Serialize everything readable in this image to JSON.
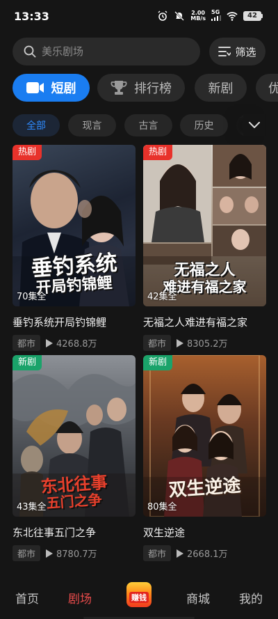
{
  "status": {
    "time": "13:33",
    "net_speed_value": "2.00",
    "net_speed_unit": "MB/s",
    "signal": "5G",
    "battery": "42"
  },
  "search": {
    "placeholder": "美乐剧场"
  },
  "filter": {
    "label": "筛选"
  },
  "main_tabs": [
    {
      "label": "短剧",
      "icon": "video-camera-icon",
      "active": true
    },
    {
      "label": "排行榜",
      "icon": "trophy-icon",
      "active": false
    },
    {
      "label": "新剧",
      "active": false
    },
    {
      "label": "优",
      "active": false
    }
  ],
  "sub_tabs": [
    {
      "label": "全部",
      "active": true
    },
    {
      "label": "现言",
      "active": false
    },
    {
      "label": "古言",
      "active": false
    },
    {
      "label": "历史",
      "active": false
    }
  ],
  "dramas": [
    {
      "title": "垂钓系统开局钓锦鲤",
      "poster_title_line1": "垂钓系统",
      "poster_title_line2": "开局钓锦鲤",
      "badge": "热剧",
      "badge_type": "hot",
      "episodes": "70集全",
      "genre": "都市",
      "views": "4268.8万"
    },
    {
      "title": "无福之人难进有福之家",
      "poster_title_line1": "无福之人",
      "poster_title_line2": "难进有福之家",
      "badge": "热剧",
      "badge_type": "hot",
      "episodes": "42集全",
      "genre": "都市",
      "views": "8305.2万"
    },
    {
      "title": "东北往事五门之争",
      "poster_title_line1": "东北往事",
      "poster_title_line2": "五门之争",
      "badge": "新剧",
      "badge_type": "new",
      "episodes": "43集全",
      "genre": "都市",
      "views": "8780.7万"
    },
    {
      "title": "双生逆途",
      "poster_title_line1": "双生逆途",
      "poster_title_line2": "",
      "badge": "新剧",
      "badge_type": "new",
      "episodes": "80集全",
      "genre": "都市",
      "views": "2668.1万"
    }
  ],
  "bottom_nav": {
    "home": "首页",
    "theater": "剧场",
    "earn": "赚钱",
    "mall": "商城",
    "mine": "我的",
    "active": "theater"
  },
  "colors": {
    "accent": "#1a7df1",
    "hot_badge": "#e8322b",
    "new_badge": "#1aa36a",
    "nav_active": "#e84b4b"
  }
}
